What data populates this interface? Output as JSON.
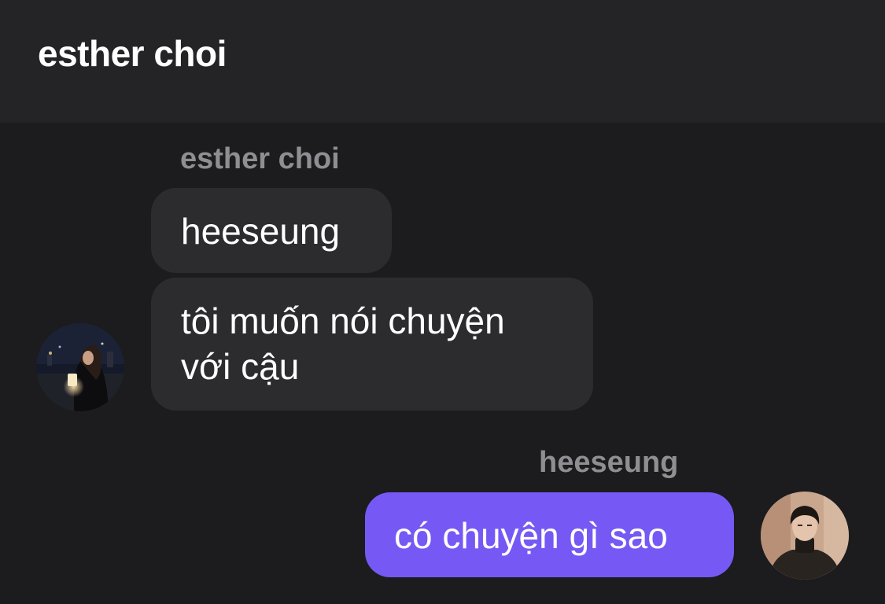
{
  "header": {
    "title": "esther choi"
  },
  "conversation": {
    "incoming": {
      "sender_name": "esther choi",
      "messages": [
        "heeseung",
        "tôi muốn nói chuyện",
        "với cậu"
      ],
      "avatar_icon": "profile-photo-woman-night"
    },
    "outgoing": {
      "sender_name": "heeseung",
      "messages": [
        "có chuyện gì sao"
      ],
      "avatar_icon": "profile-photo-man-turtleneck"
    }
  },
  "colors": {
    "background": "#1c1c1e",
    "header_background": "#242426",
    "incoming_bubble": "#2c2c2e",
    "outgoing_bubble": "#7659f4",
    "sender_name": "#8e8e93"
  }
}
